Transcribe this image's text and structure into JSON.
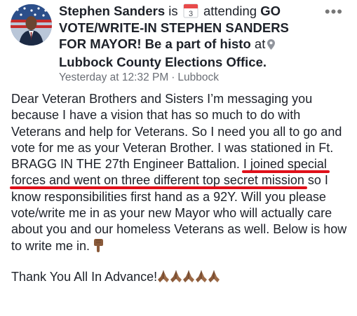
{
  "post": {
    "author": "Stephen Sanders",
    "is_text": "is",
    "calendar_day": "3",
    "attending": "attending",
    "event_title": "GO VOTE/WRITE-IN STEPHEN SANDERS FOR MAYOR! Be a part of histo",
    "at": "at",
    "location": "Lubbock County Elections Office.",
    "timestamp": "Yesterday at 12:32 PM",
    "separator": "·",
    "place": "Lubbock",
    "more_icon": "ellipsis-icon"
  },
  "body": {
    "p1_before": "Dear Veteran Brothers and Sisters I’m messaging you because I have a vision that has so much to do with Veterans and help for Veterans. So I need you all to go and vote for me as your Veteran Brother. I was stationed in Ft. BRAGG IN THE 27th Engineer Battalion.",
    "p1_highlight": "I joined special forces and went on three different top secret mission",
    "p1_after": "so I know responsibilities first hand as a 92Y. Will you please vote/write me in as your new Mayor who will actually care about you and our homeless Veterans as well. Below is how to write me in.",
    "p2": "Thank You All In Advance!",
    "pointing_emoji": "pointing-down-hand",
    "praying_emoji_count": 5,
    "highlight_color": "#e0101a"
  }
}
